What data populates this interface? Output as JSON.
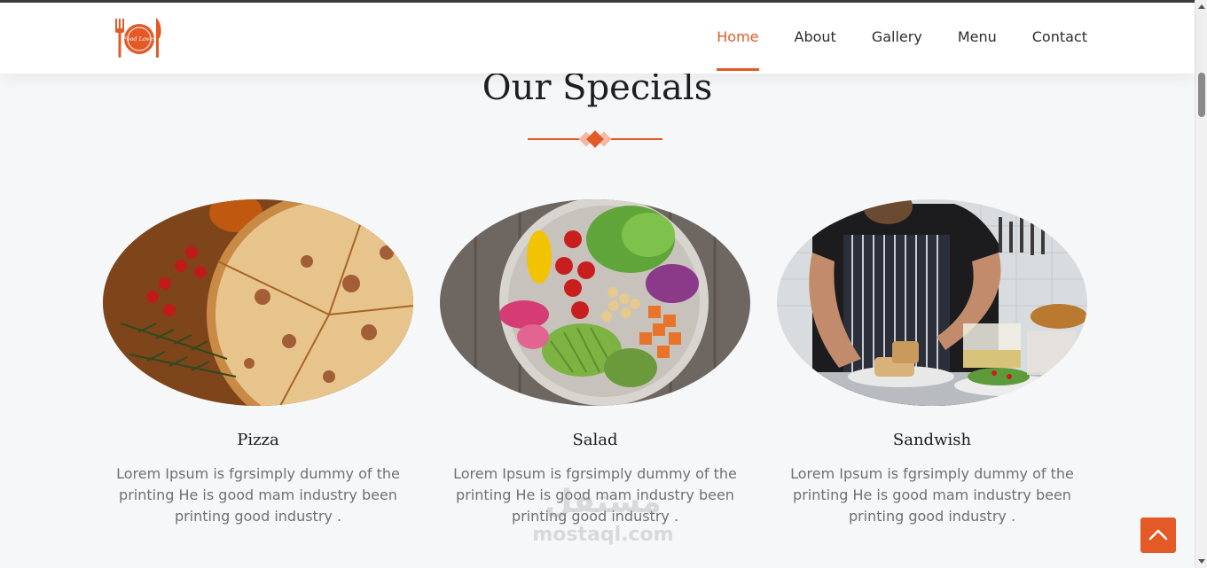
{
  "brand": {
    "logo_text": "Food Lover",
    "accent": "#e35a27"
  },
  "nav": {
    "items": [
      {
        "label": "Home",
        "active": true
      },
      {
        "label": "About",
        "active": false
      },
      {
        "label": "Gallery",
        "active": false
      },
      {
        "label": "Menu",
        "active": false
      },
      {
        "label": "Contact",
        "active": false
      }
    ]
  },
  "specials": {
    "title": "Our Specials",
    "items": [
      {
        "name": "Pizza",
        "description": "Lorem Ipsum is fgrsimply dummy of the printing He is good mam industry been printing good industry ."
      },
      {
        "name": "Salad",
        "description": "Lorem Ipsum is fgrsimply dummy of the printing He is good mam industry been printing good industry ."
      },
      {
        "name": "Sandwish",
        "description": "Lorem Ipsum is fgrsimply dummy of the printing He is good mam industry been printing good industry ."
      }
    ]
  },
  "watermark": {
    "arabic": "مستقل",
    "latin": "mostaql.com"
  },
  "icons": {
    "back_to_top": "chevron-up-icon"
  }
}
